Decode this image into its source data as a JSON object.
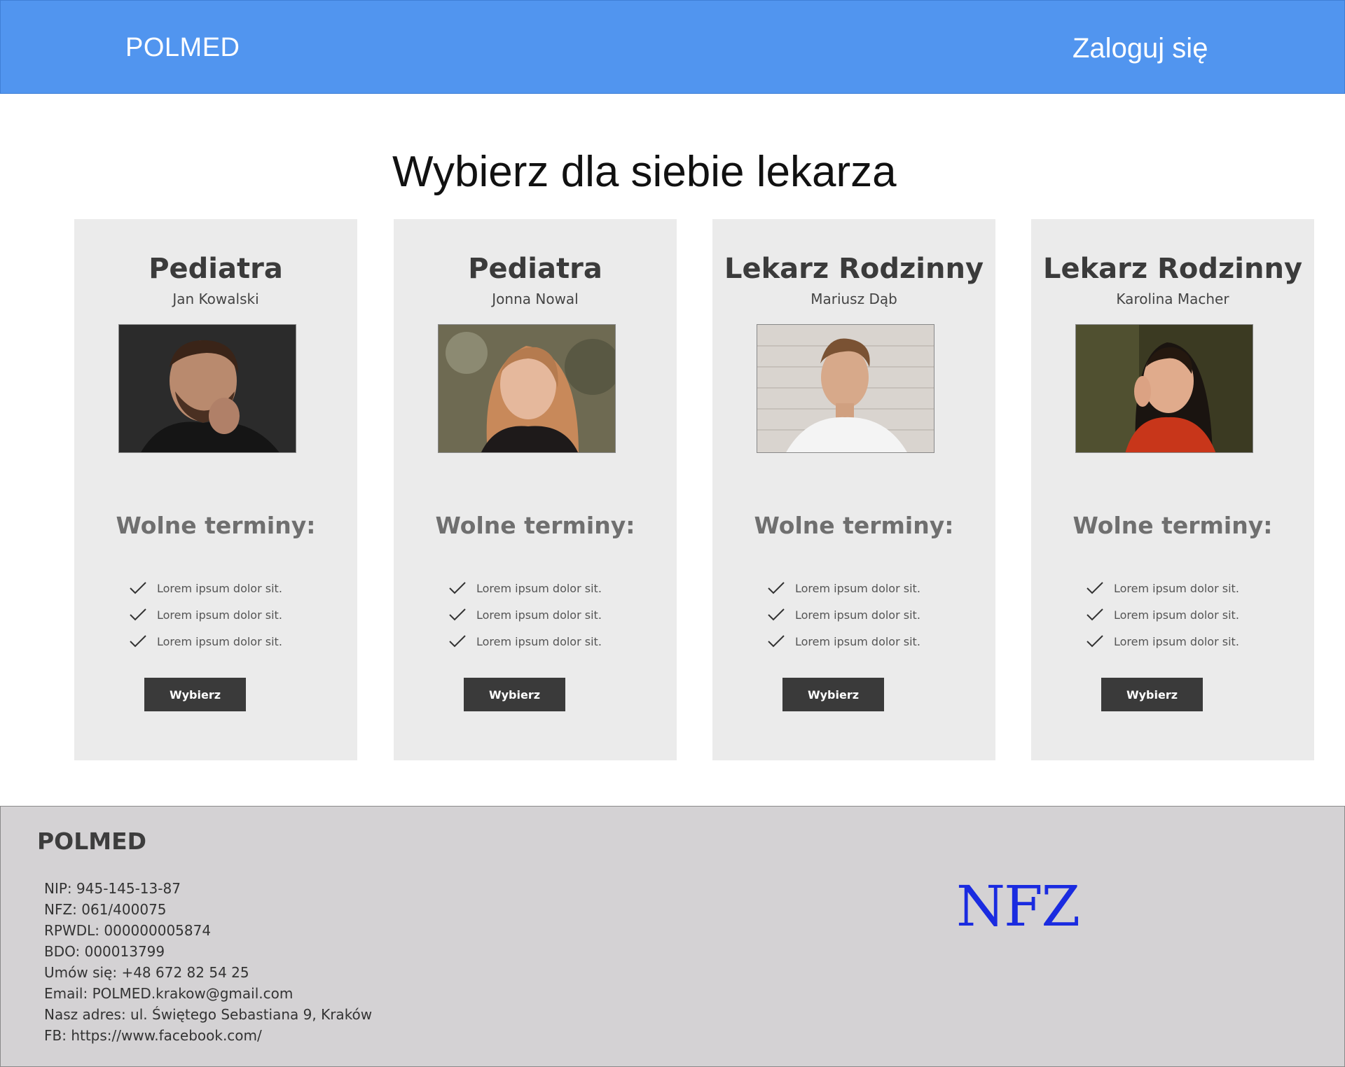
{
  "header": {
    "brand": "POLMED",
    "login_label": "Zaloguj się"
  },
  "main": {
    "title": "Wybierz dla siebie lekarza"
  },
  "cards": [
    {
      "specialty": "Pediatra",
      "name": "Jan Kowalski",
      "slots_title": "Wolne terminy:",
      "slots": [
        "Lorem ipsum dolor sit.",
        "Lorem ipsum dolor sit.",
        "Lorem ipsum dolor sit."
      ],
      "button_label": "Wybierz"
    },
    {
      "specialty": "Pediatra",
      "name": "Jonna Nowal",
      "slots_title": "Wolne terminy:",
      "slots": [
        "Lorem ipsum dolor sit.",
        "Lorem ipsum dolor sit.",
        "Lorem ipsum dolor sit."
      ],
      "button_label": "Wybierz"
    },
    {
      "specialty": "Lekarz Rodzinny",
      "name": "Mariusz Dąb",
      "slots_title": "Wolne terminy:",
      "slots": [
        "Lorem ipsum dolor sit.",
        "Lorem ipsum dolor sit.",
        "Lorem ipsum dolor sit."
      ],
      "button_label": "Wybierz"
    },
    {
      "specialty": "Lekarz Rodzinny",
      "name": "Karolina Macher",
      "slots_title": "Wolne terminy:",
      "slots": [
        "Lorem ipsum dolor sit.",
        "Lorem ipsum dolor sit.",
        "Lorem ipsum dolor sit."
      ],
      "button_label": "Wybierz"
    }
  ],
  "footer": {
    "brand": "POLMED",
    "info": [
      "NIP: 945-145-13-87",
      "NFZ: 061/400075",
      "RPWDL: 000000005874",
      "BDO: 000013799",
      "Umów się: +48 672 82 54 25",
      "Email: POLMED.krakow@gmail.com",
      "Nasz adres: ul. Świętego Sebastiana 9, Kraków",
      "FB: https://www.facebook.com/"
    ],
    "logo_text": "NFZ"
  },
  "colors": {
    "header_bg": "#5195ef",
    "card_bg": "#ebebeb",
    "button_bg": "#3a3a3a",
    "footer_bg": "#d4d2d4",
    "nfz_blue": "#1a2be0"
  }
}
